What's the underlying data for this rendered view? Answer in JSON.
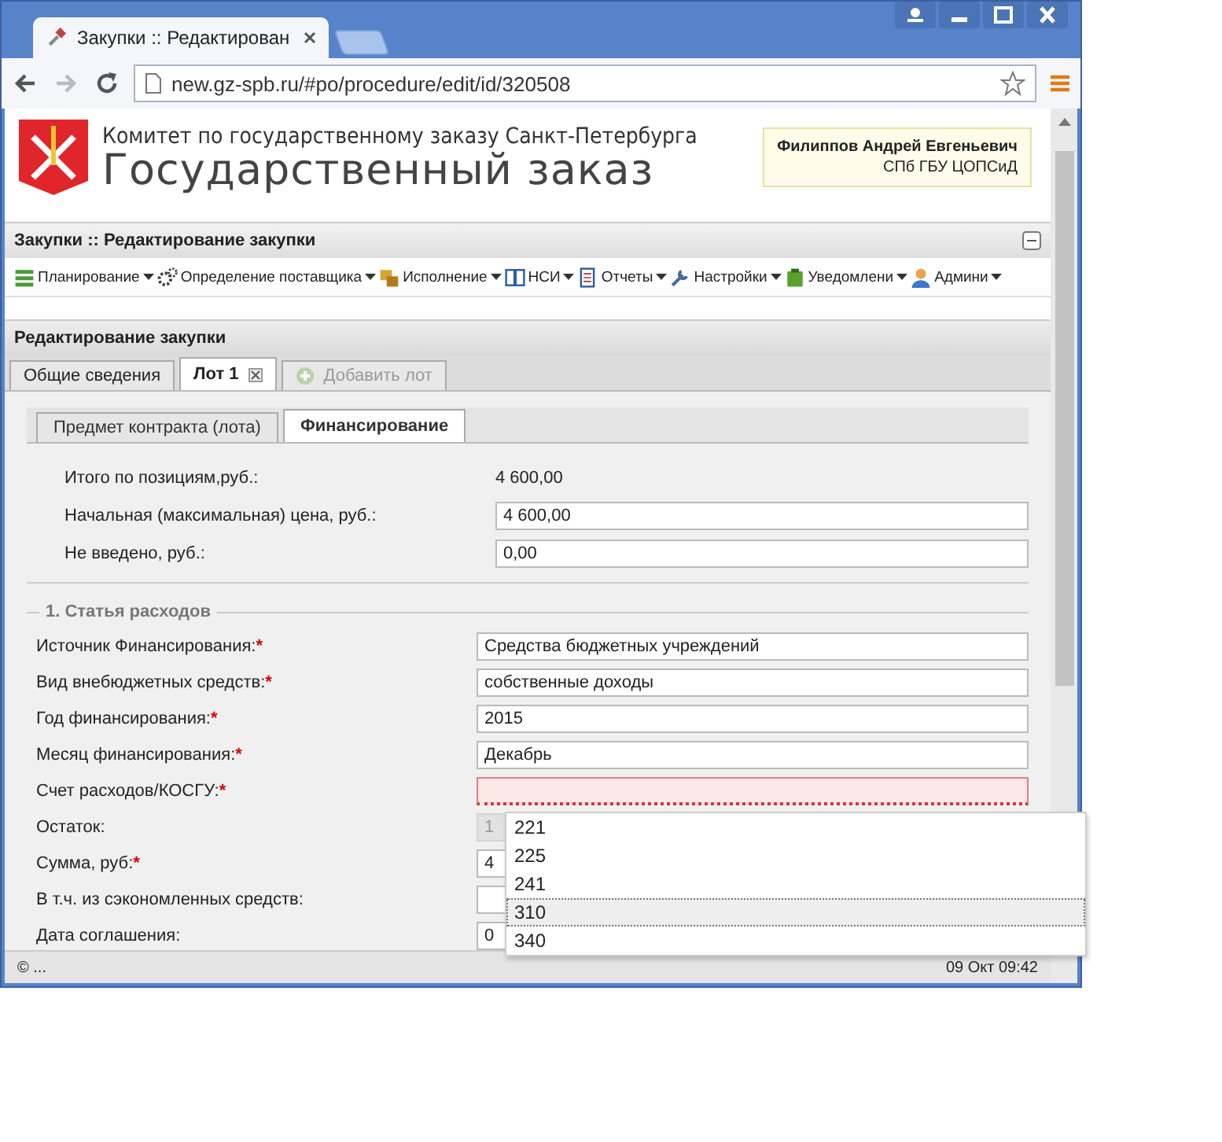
{
  "browser": {
    "tab_title": "Закупки :: Редактирован",
    "url": "new.gz-spb.ru/#po/procedure/edit/id/320508"
  },
  "header": {
    "org": "Комитет по государственному заказу Санкт-Петербурга",
    "title": "Государственный заказ",
    "user_name": "Филиппов Андрей Евгеньевич",
    "user_org": "СПб ГБУ ЦОПСиД"
  },
  "panel_title": "Закупки :: Редактирование закупки",
  "menu": [
    {
      "label": "Планирование",
      "kind": "plan"
    },
    {
      "label": "Определение поставщика",
      "kind": "gears"
    },
    {
      "label": "Исполнение",
      "kind": "box"
    },
    {
      "label": "НСИ",
      "kind": "book"
    },
    {
      "label": "Отчеты",
      "kind": "report"
    },
    {
      "label": "Настройки",
      "kind": "wrench"
    },
    {
      "label": "Уведомлени",
      "kind": "clipboard"
    },
    {
      "label": "Админи",
      "kind": "person"
    }
  ],
  "editor_title": "Редактирование закупки",
  "lot_tabs": [
    {
      "label": "Общие сведения",
      "selected": false,
      "disabled": false,
      "closable": false
    },
    {
      "label": "Лот 1",
      "selected": true,
      "disabled": false,
      "closable": true
    },
    {
      "label": "Добавить лот",
      "selected": false,
      "disabled": true,
      "closable": false
    }
  ],
  "sub_tabs": [
    {
      "label": "Предмет контракта (лота)",
      "selected": false
    },
    {
      "label": "Финансирование",
      "selected": true
    }
  ],
  "summary": [
    {
      "label": "Итого по позициям,руб.:",
      "value": "4 600,00",
      "kind": "text"
    },
    {
      "label": "Начальная (максимальная) цена, руб.:",
      "value": "4 600,00",
      "kind": "input"
    },
    {
      "label": "Не введено, руб.:",
      "value": "0,00",
      "kind": "input"
    }
  ],
  "section_title": "1. Статья расходов",
  "required_mark": "*",
  "fields": [
    {
      "label": "Источник Финансирования:",
      "required": true,
      "value": "Средства бюджетных учреждений",
      "invalid": false,
      "disabled": false
    },
    {
      "label": "Вид внебюджетных средств:",
      "required": true,
      "value": "собственные доходы",
      "invalid": false,
      "disabled": false
    },
    {
      "label": "Год финансирования:",
      "required": true,
      "value": "2015",
      "invalid": false,
      "disabled": false
    },
    {
      "label": "Месяц финансирования:",
      "required": true,
      "value": "Декабрь",
      "invalid": false,
      "disabled": false
    },
    {
      "label": "Счет расходов/КОСГУ:",
      "required": true,
      "invalid": true,
      "disabled": false
    },
    {
      "label": "Остаток:",
      "required": false,
      "value": "1",
      "invalid": false,
      "disabled": true
    },
    {
      "label": "Сумма, руб:",
      "required": true,
      "value": "4",
      "invalid": false,
      "disabled": false
    },
    {
      "label": "В т.ч. из сэкономленных средств:",
      "required": false,
      "invalid": false,
      "disabled": false
    },
    {
      "label": "Дата соглашения:",
      "required": false,
      "value": "0",
      "invalid": false,
      "disabled": false
    }
  ],
  "dropdown": [
    {
      "label": "221",
      "selected": false
    },
    {
      "label": "225",
      "selected": false
    },
    {
      "label": "241",
      "selected": false
    },
    {
      "label": "310",
      "selected": true
    },
    {
      "label": "340",
      "selected": false
    }
  ],
  "status_bar": {
    "left": "© ...",
    "right": "09 Окт 09:42"
  }
}
